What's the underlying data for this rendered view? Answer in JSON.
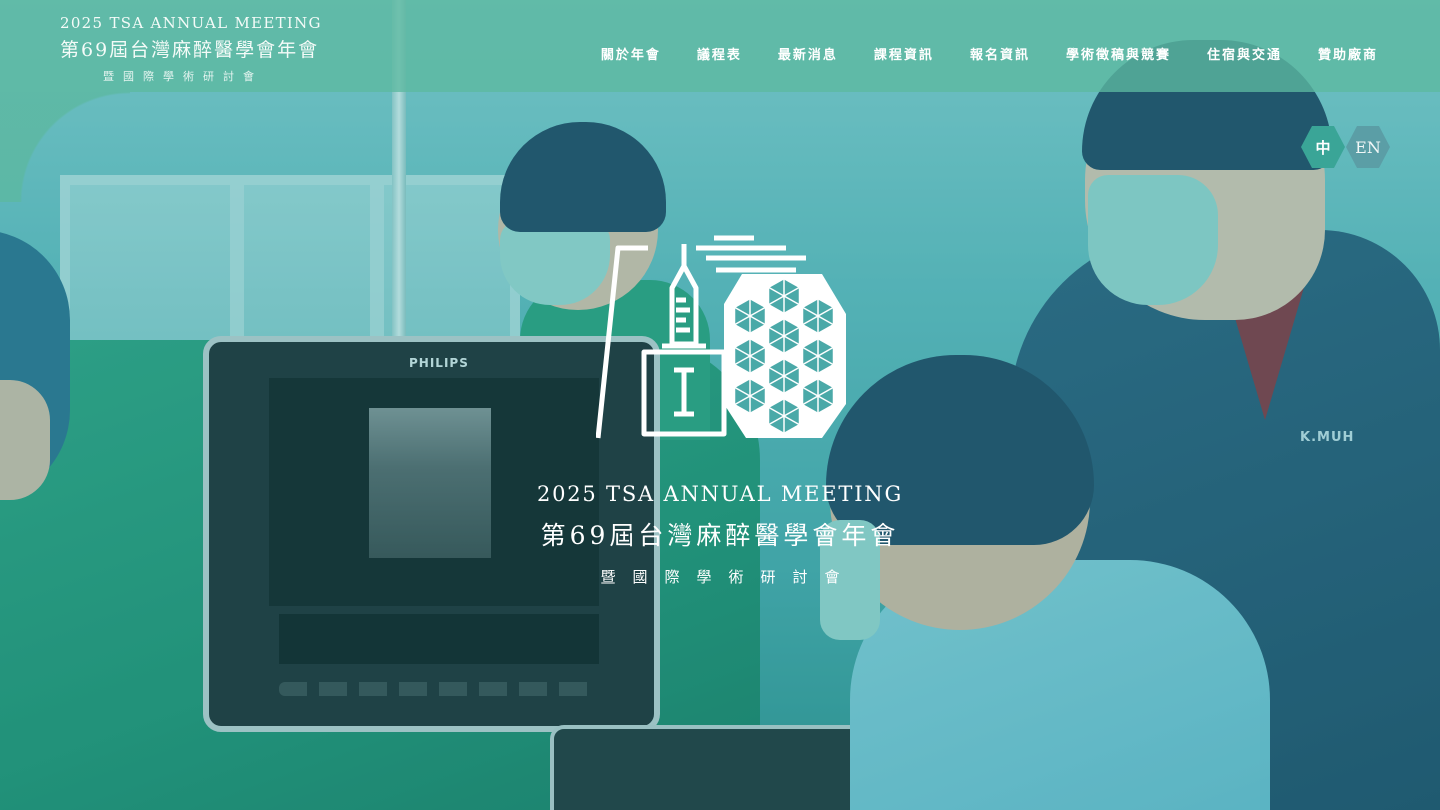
{
  "header": {
    "logo": {
      "title_en": "2025 TSA ANNUAL MEETING",
      "title_zh": "第69屆台灣麻醉醫學會年會",
      "subtitle": "暨國際學術研討會"
    },
    "nav": [
      {
        "label": "關於年會"
      },
      {
        "label": "議程表"
      },
      {
        "label": "最新消息"
      },
      {
        "label": "課程資訊"
      },
      {
        "label": "報名資訊"
      },
      {
        "label": "學術徵稿與競賽"
      },
      {
        "label": "住宿與交通"
      },
      {
        "label": "贊助廠商"
      }
    ]
  },
  "language": {
    "zh_label": "中",
    "en_label": "EN",
    "active": "中"
  },
  "hero": {
    "title_en": "2025 TSA ANNUAL MEETING",
    "title_zh": "第69屆台灣麻醉醫學會年會",
    "subtitle": "暨國際學術研討會"
  },
  "photo_labels": {
    "monitor_brand": "PHILIPS",
    "scrub_name": "K.MUH"
  },
  "colors": {
    "header_bg": "#5cb8a0",
    "lang_active": "#3aa597",
    "lang_inactive": "#5b9ea6",
    "text": "#ffffff"
  },
  "icons": {
    "emblem": "syringe-hexagon-emblem"
  }
}
